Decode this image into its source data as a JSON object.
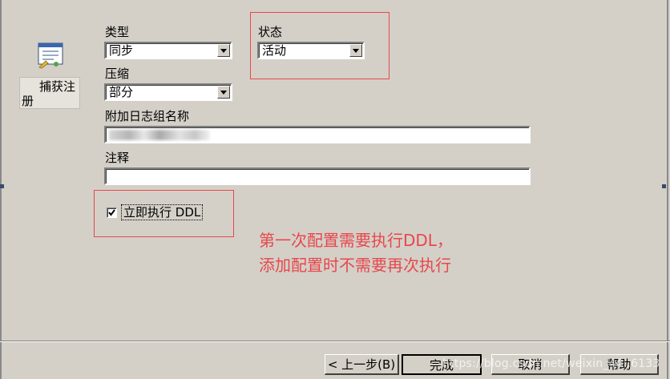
{
  "registration": {
    "label": "捕获注册"
  },
  "fields": {
    "type": {
      "label": "类型",
      "value": "同步"
    },
    "status": {
      "label": "状态",
      "value": "活动"
    },
    "compression": {
      "label": "压缩",
      "value": "部分"
    },
    "log_group": {
      "label": "附加日志组名称",
      "value": ""
    },
    "comment": {
      "label": "注释",
      "value": ""
    }
  },
  "execute_ddl": {
    "label": "立即执行 DDL",
    "checked": true
  },
  "annotation": {
    "line1": "第一次配置需要执行DDL，",
    "line2": "添加配置时不需要再次执行"
  },
  "buttons": {
    "back": "< 上一步(B)",
    "finish": "完成",
    "cancel": "取消",
    "help": "帮助"
  },
  "watermark": "https://blog.csdn.net/weixin_44..6133",
  "colors": {
    "annotation_red": "#e8474b",
    "dialog_bg": "#d4d0c8"
  }
}
